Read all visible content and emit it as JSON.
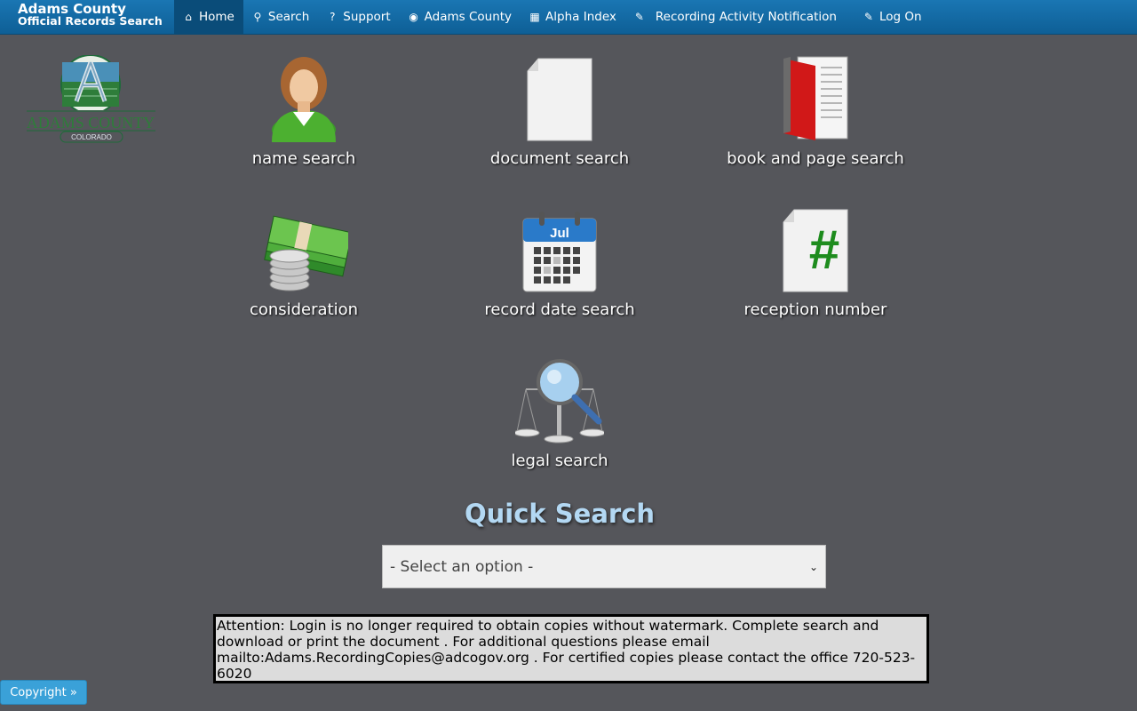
{
  "brand": {
    "line1": "Adams County",
    "line2": "Official Records Search"
  },
  "nav": [
    {
      "label": "Home",
      "icon": "home-icon",
      "glyph": "⌂"
    },
    {
      "label": "Search",
      "icon": "search-icon",
      "glyph": "⚲"
    },
    {
      "label": "Support",
      "icon": "question-icon",
      "glyph": "?"
    },
    {
      "label": "Adams County",
      "icon": "globe-icon",
      "glyph": "◉"
    },
    {
      "label": "Alpha Index",
      "icon": "table-icon",
      "glyph": "▦"
    },
    {
      "label": "Recording Activity Notification",
      "icon": "wrench-icon",
      "glyph": "✎"
    },
    {
      "label": "Log On",
      "icon": "pencil-icon",
      "glyph": "✎"
    }
  ],
  "logo": {
    "name": "ADAMS COUNTY",
    "state": "COLORADO",
    "colors": {
      "green": "#1f6b3a",
      "blue": "#4a90b8"
    }
  },
  "tiles": [
    {
      "label": "name search",
      "icon": "person-icon"
    },
    {
      "label": "document search",
      "icon": "document-icon"
    },
    {
      "label": "book and page search",
      "icon": "book-icon"
    },
    {
      "label": "consideration",
      "icon": "money-icon"
    },
    {
      "label": "record date search",
      "icon": "calendar-icon",
      "month": "Jul"
    },
    {
      "label": "reception number",
      "icon": "hash-document-icon",
      "symbol": "#"
    },
    {
      "label": "legal search",
      "icon": "scales-magnifier-icon"
    }
  ],
  "quick_search": {
    "title": "Quick Search",
    "selected": "- Select an option -"
  },
  "notice": {
    "text": " Attention: Login is no longer required to obtain copies without watermark. Complete search and download or print the document . For additional questions please email mailto:Adams.RecordingCopies@adcogov.org . For certified copies please contact the office 720-523-6020"
  },
  "footer": {
    "copyright_label": "Copyright »"
  }
}
